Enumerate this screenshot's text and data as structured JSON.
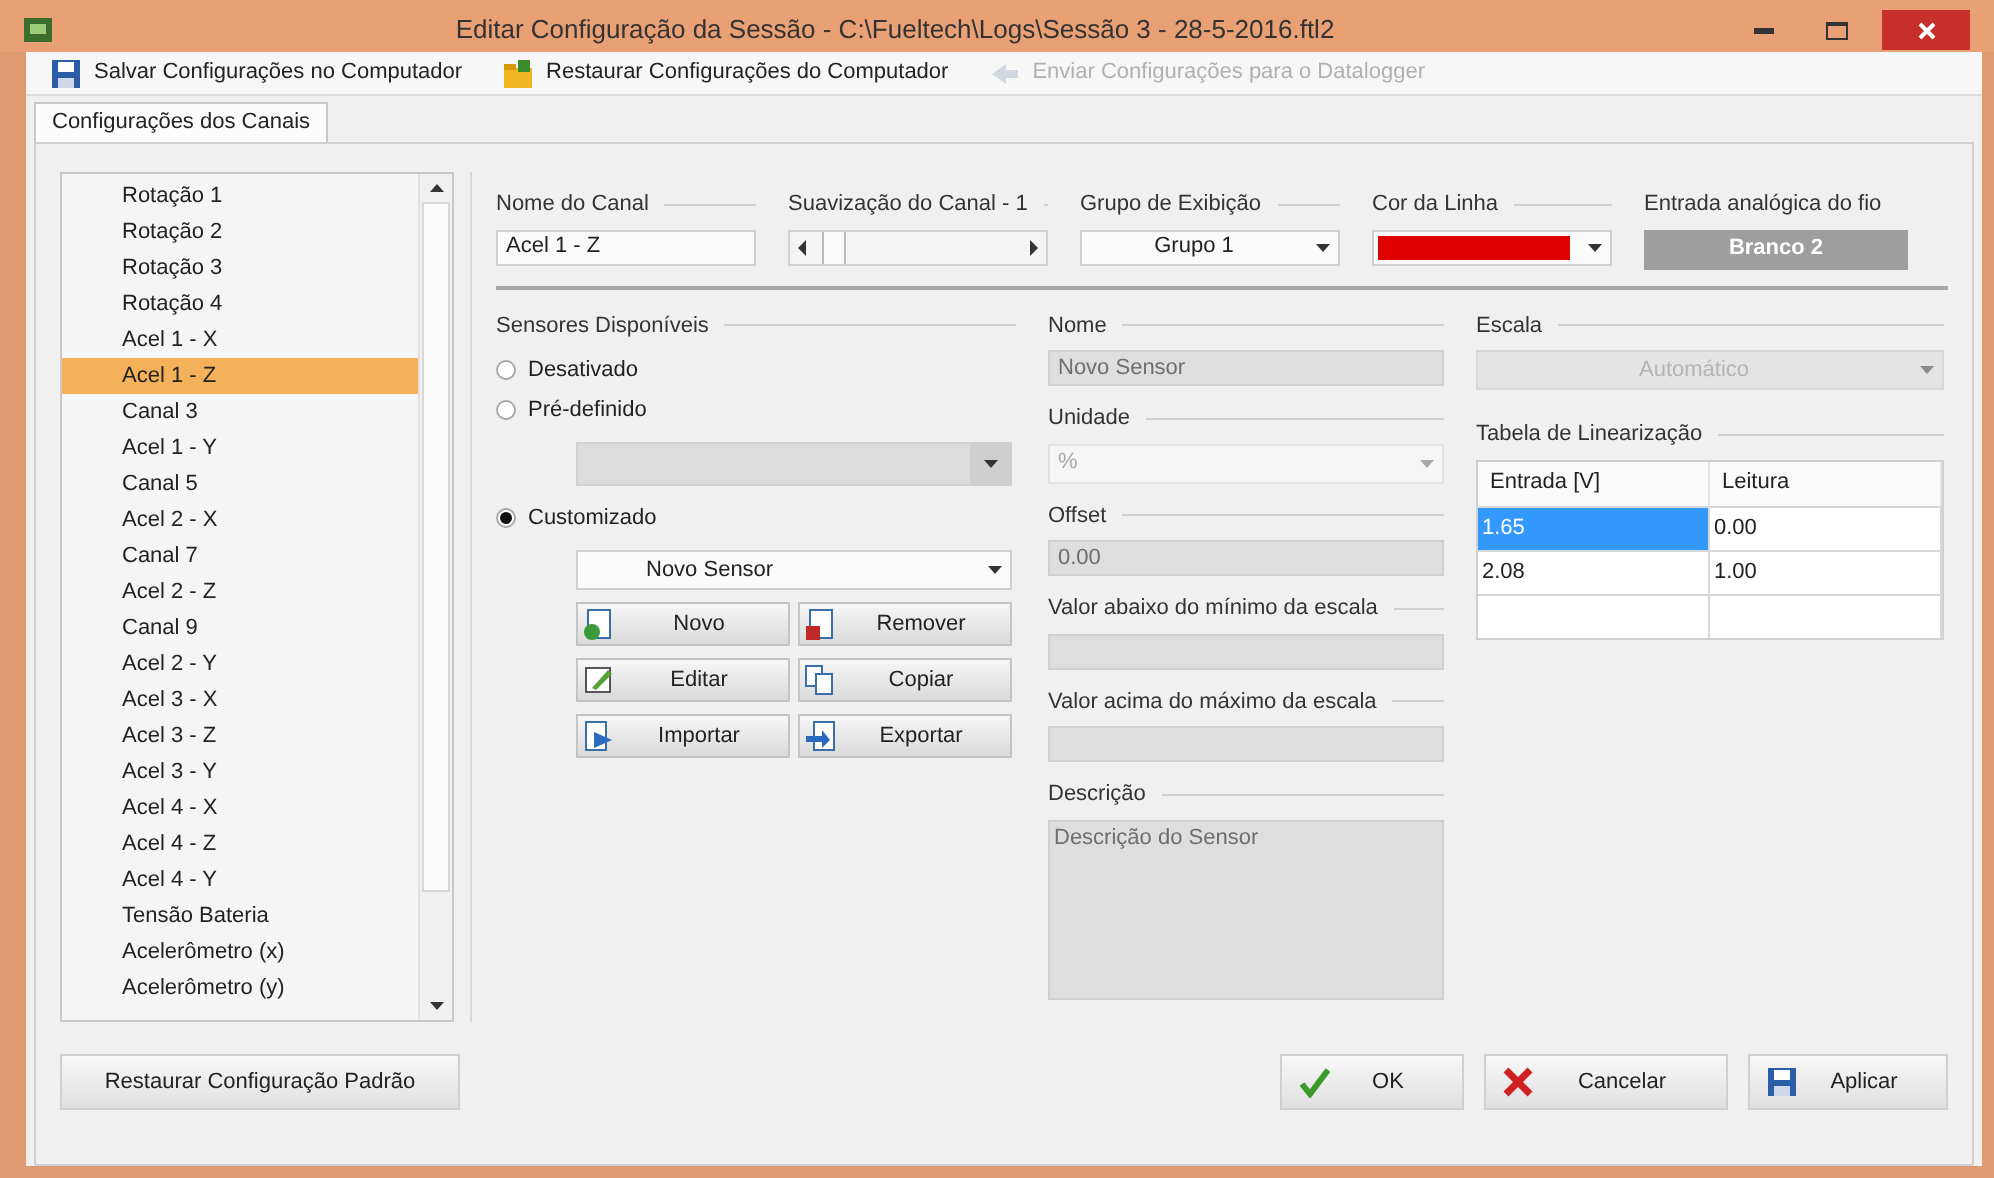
{
  "window": {
    "title": "Editar Configuração da Sessão - C:\\Fueltech\\Logs\\Sessão 3 - 28-5-2016.ftl2"
  },
  "toolbar": [
    {
      "label": "Salvar Configurações no Computador",
      "kind": "save",
      "disabled": false
    },
    {
      "label": "Restaurar Configurações do Computador",
      "kind": "restore",
      "disabled": false
    },
    {
      "label": "Enviar Configurações para o Datalogger",
      "kind": "send",
      "disabled": true
    }
  ],
  "tabs": [
    {
      "label": "Configurações dos Canais",
      "selected": true
    }
  ],
  "channels": [
    {
      "label": "Rotação 1",
      "selected": false
    },
    {
      "label": "Rotação 2",
      "selected": false
    },
    {
      "label": "Rotação 3",
      "selected": false
    },
    {
      "label": "Rotação 4",
      "selected": false
    },
    {
      "label": "Acel 1 - X",
      "selected": false
    },
    {
      "label": "Acel 1 - Z",
      "selected": true
    },
    {
      "label": "Canal 3",
      "selected": false
    },
    {
      "label": "Acel 1 - Y",
      "selected": false
    },
    {
      "label": "Canal 5",
      "selected": false
    },
    {
      "label": "Acel 2 - X",
      "selected": false
    },
    {
      "label": "Canal 7",
      "selected": false
    },
    {
      "label": "Acel 2 - Z",
      "selected": false
    },
    {
      "label": "Canal 9",
      "selected": false
    },
    {
      "label": "Acel 2 - Y",
      "selected": false
    },
    {
      "label": "Acel 3 - X",
      "selected": false
    },
    {
      "label": "Acel 3 - Z",
      "selected": false
    },
    {
      "label": "Acel 3 - Y",
      "selected": false
    },
    {
      "label": "Acel 4 - X",
      "selected": false
    },
    {
      "label": "Acel 4 - Z",
      "selected": false
    },
    {
      "label": "Acel 4 - Y",
      "selected": false
    },
    {
      "label": "Tensão Bateria",
      "selected": false
    },
    {
      "label": "Acelerômetro (x)",
      "selected": false
    },
    {
      "label": "Acelerômetro (y)",
      "selected": false
    }
  ],
  "channel_name": {
    "label": "Nome do Canal",
    "value": "Acel 1 - Z"
  },
  "smoothing": {
    "label": "Suavização do Canal - 1",
    "level": 0.1
  },
  "display_group": {
    "label": "Grupo de Exibição",
    "value": "Grupo 1"
  },
  "line_color": {
    "label": "Cor da Linha",
    "color": "#e00000"
  },
  "analog_input": {
    "label": "Entrada analógica do fio",
    "value": "Branco 2",
    "disabled": true
  },
  "sensors": {
    "label": "Sensores Disponíveis",
    "options": [
      {
        "label": "Desativado",
        "selected": false
      },
      {
        "label": "Pré-definido",
        "selected": false
      },
      {
        "label": "Customizado",
        "selected": true
      }
    ],
    "custom_value": "Novo Sensor",
    "buttons": [
      {
        "label": "Novo",
        "kind": "new"
      },
      {
        "label": "Remover",
        "kind": "remove"
      },
      {
        "label": "Editar",
        "kind": "edit"
      },
      {
        "label": "Copiar",
        "kind": "copy"
      },
      {
        "label": "Importar",
        "kind": "import"
      },
      {
        "label": "Exportar",
        "kind": "export"
      }
    ]
  },
  "sensor_fields": [
    {
      "label": "Nome",
      "value": "Novo Sensor",
      "kind": "text"
    },
    {
      "label": "Unidade",
      "value": "%",
      "kind": "select"
    },
    {
      "label": "Offset",
      "value": "0.00",
      "kind": "text"
    },
    {
      "label": "Valor abaixo do mínimo da escala",
      "kind": "text"
    },
    {
      "label": "Valor acima do máximo da escala",
      "kind": "text"
    },
    {
      "label": "Descrição",
      "value": "Descrição do Sensor",
      "kind": "textarea"
    }
  ],
  "scale": {
    "label": "Escala",
    "value": "Automático"
  },
  "linearization": {
    "title": "Tabela de Linearização",
    "columns": [
      "Entrada [V]",
      "Leitura"
    ],
    "rows": [
      [
        {
          "text": "1.65",
          "selected": true
        },
        {
          "text": "0.00",
          "selected": false
        }
      ],
      [
        {
          "text": "2.08",
          "selected": false
        },
        {
          "text": "1.00",
          "selected": false
        }
      ],
      [
        {
          "selected": false
        },
        {
          "selected": false
        }
      ]
    ]
  },
  "footer": {
    "restore": "Restaurar Configuração Padrão",
    "buttons": [
      {
        "label": "OK",
        "kind": "ok"
      },
      {
        "label": "Cancelar",
        "kind": "cancel"
      },
      {
        "label": "Aplicar",
        "kind": "apply"
      }
    ]
  }
}
